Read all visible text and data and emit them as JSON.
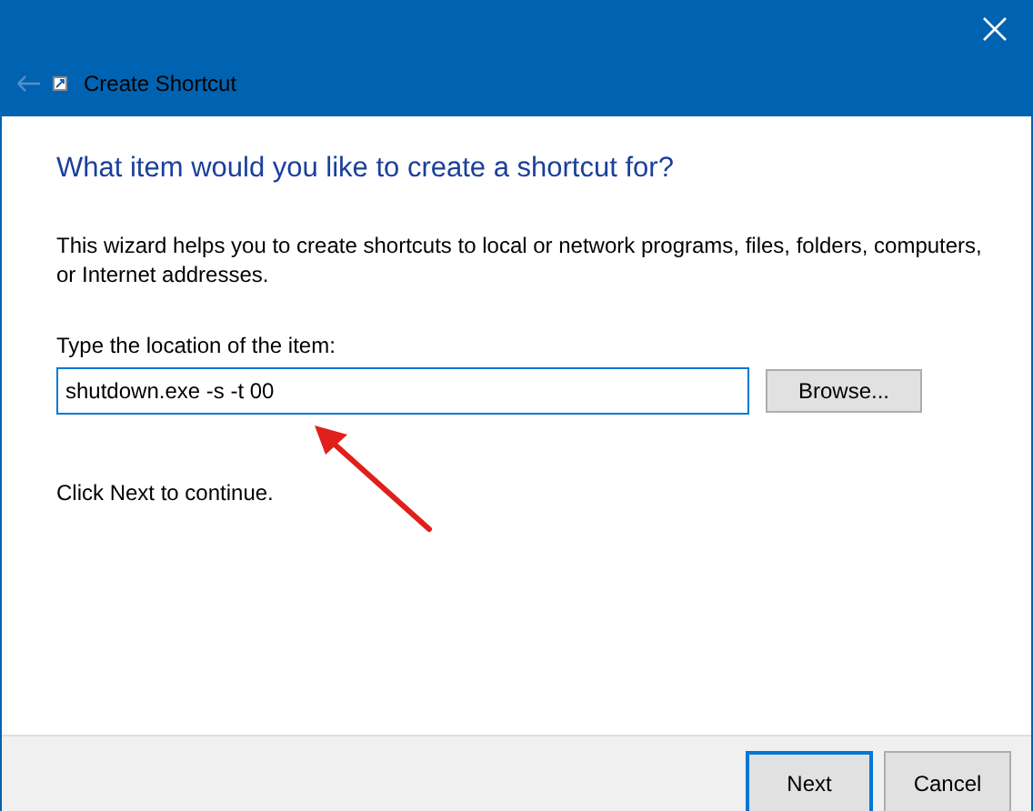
{
  "window": {
    "title": "Create Shortcut",
    "back_disabled": true
  },
  "heading": "What item would you like to create a shortcut for?",
  "description": "This wizard helps you to create shortcuts to local or network programs, files, folders, computers, or Internet addresses.",
  "location": {
    "label": "Type the location of the item:",
    "value": "shutdown.exe -s -t 00",
    "focused": true
  },
  "browse_button": "Browse...",
  "hint": "Click Next to continue.",
  "buttons": [
    {
      "label": "Next",
      "default": true
    },
    {
      "label": "Cancel",
      "default": false
    }
  ]
}
